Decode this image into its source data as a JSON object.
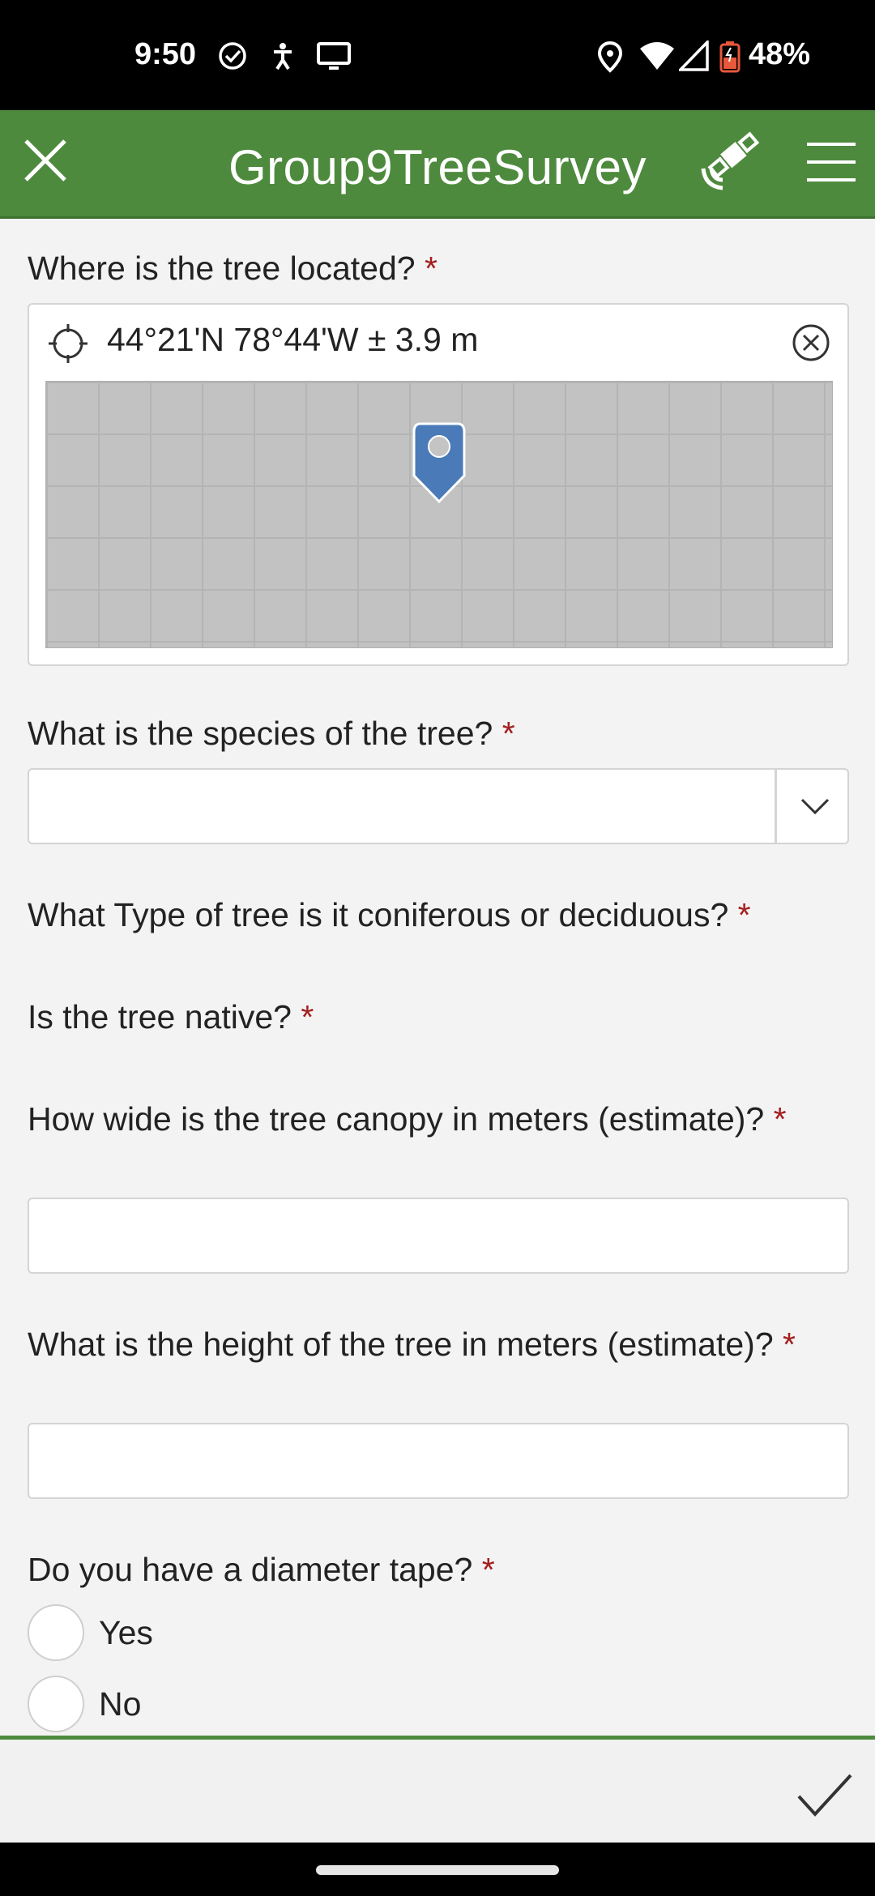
{
  "status_bar": {
    "time": "9:50",
    "battery": "48%",
    "icons": [
      "check-circle-icon",
      "accessibility-icon",
      "cast-screen-icon",
      "location-pin-icon",
      "wifi-icon",
      "cell-signal-icon",
      "battery-icon"
    ]
  },
  "app_bar": {
    "title": "Group9TreeSurvey",
    "close_icon": "close-icon",
    "gps_icon": "satellite-icon",
    "menu_icon": "menu-icon",
    "background_color": "#4e8a3e"
  },
  "form": {
    "required_marker": "*",
    "required_color": "#a31f1f",
    "location": {
      "label": "Where is the tree located?",
      "coordinates": "44°21'N 78°44'W ± 3.9 m"
    },
    "species": {
      "label": "What is the species of the tree?",
      "value": ""
    },
    "tree_type": {
      "label": "What Type of tree is it coniferous or deciduous?"
    },
    "native": {
      "label": "Is the tree native?"
    },
    "canopy": {
      "label": "How wide is the tree canopy in meters (estimate)?",
      "value": ""
    },
    "height": {
      "label": "What is the height of the tree in meters (estimate)?",
      "value": ""
    },
    "diameter_tape": {
      "label": "Do you have a diameter tape?",
      "options": [
        "Yes",
        "No"
      ]
    }
  },
  "footer": {
    "submit_icon": "checkmark-icon"
  }
}
